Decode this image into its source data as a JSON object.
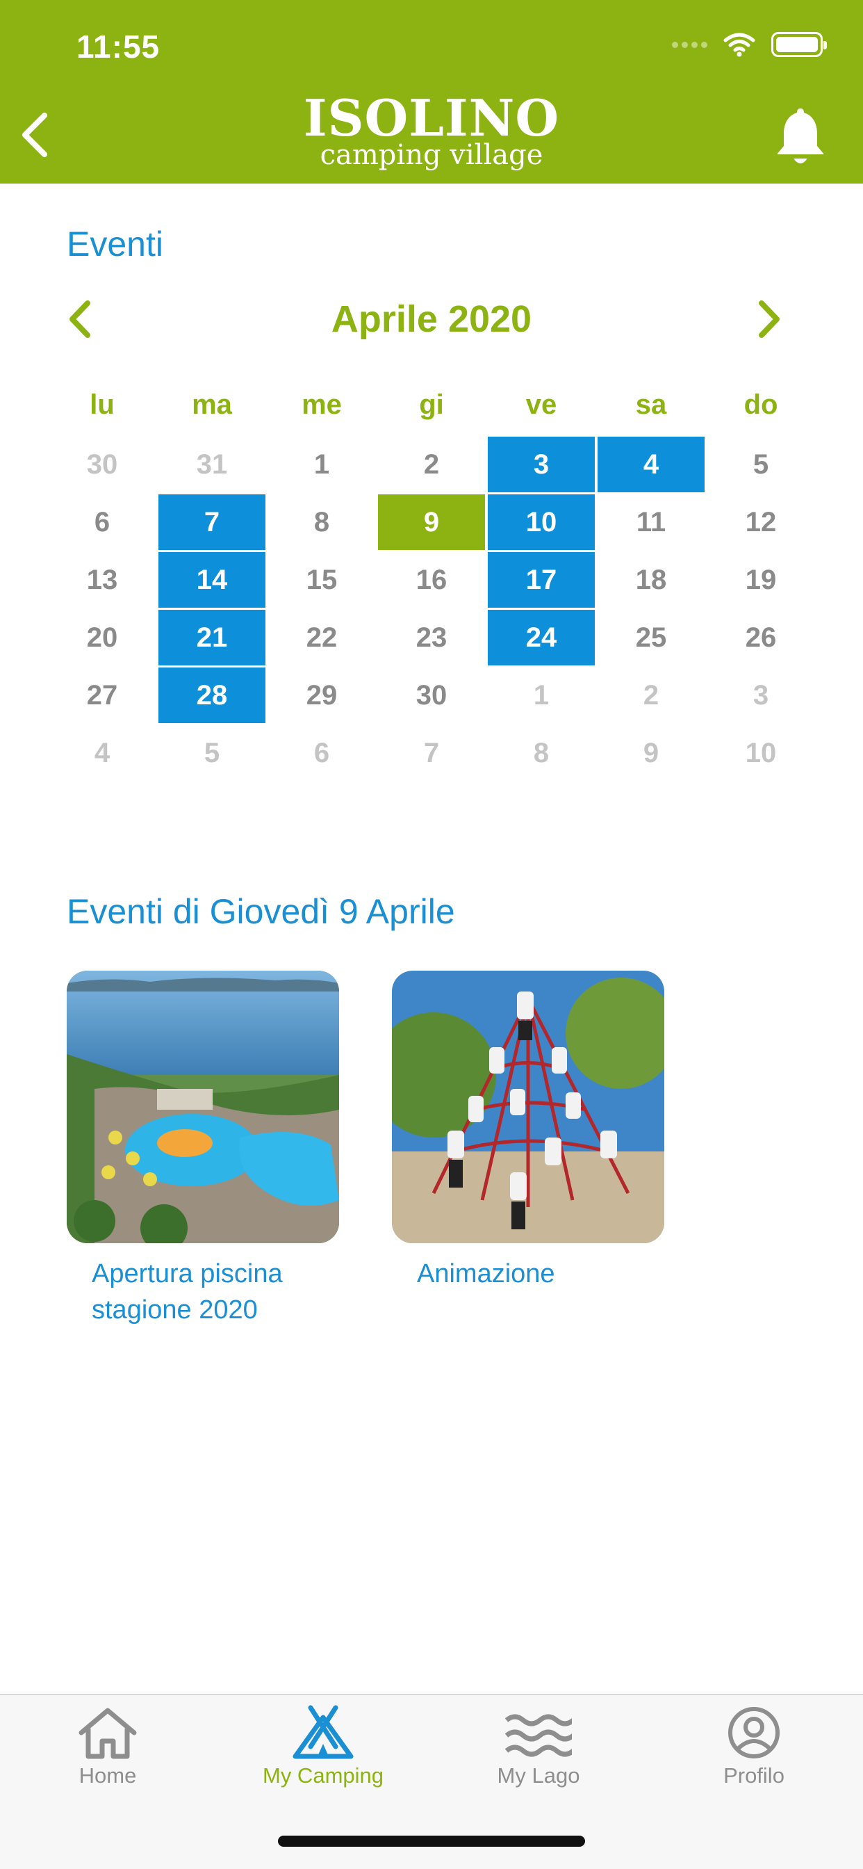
{
  "status_bar": {
    "time": "11:55"
  },
  "header": {
    "logo_main": "ISOLINO",
    "logo_sub": "camping village",
    "brand_color": "#8db312"
  },
  "events_section": {
    "title": "Eventi"
  },
  "calendar": {
    "month_label": "Aprile 2020",
    "weekdays": [
      "lu",
      "ma",
      "me",
      "gi",
      "ve",
      "sa",
      "do"
    ],
    "event_color": "#0d8fd9",
    "selected_color": "#8db312",
    "weeks": [
      [
        {
          "d": "30",
          "m": true
        },
        {
          "d": "31",
          "m": true
        },
        {
          "d": "1"
        },
        {
          "d": "2"
        },
        {
          "d": "3",
          "e": true
        },
        {
          "d": "4",
          "e": true
        },
        {
          "d": "5"
        }
      ],
      [
        {
          "d": "6"
        },
        {
          "d": "7",
          "e": true
        },
        {
          "d": "8"
        },
        {
          "d": "9",
          "s": true
        },
        {
          "d": "10",
          "e": true
        },
        {
          "d": "11"
        },
        {
          "d": "12"
        }
      ],
      [
        {
          "d": "13"
        },
        {
          "d": "14",
          "e": true
        },
        {
          "d": "15"
        },
        {
          "d": "16"
        },
        {
          "d": "17",
          "e": true
        },
        {
          "d": "18"
        },
        {
          "d": "19"
        }
      ],
      [
        {
          "d": "20"
        },
        {
          "d": "21",
          "e": true
        },
        {
          "d": "22"
        },
        {
          "d": "23"
        },
        {
          "d": "24",
          "e": true
        },
        {
          "d": "25"
        },
        {
          "d": "26"
        }
      ],
      [
        {
          "d": "27"
        },
        {
          "d": "28",
          "e": true
        },
        {
          "d": "29"
        },
        {
          "d": "30"
        },
        {
          "d": "1",
          "m": true
        },
        {
          "d": "2",
          "m": true
        },
        {
          "d": "3",
          "m": true
        }
      ],
      [
        {
          "d": "4",
          "m": true
        },
        {
          "d": "5",
          "m": true
        },
        {
          "d": "6",
          "m": true
        },
        {
          "d": "7",
          "m": true
        },
        {
          "d": "8",
          "m": true
        },
        {
          "d": "9",
          "m": true
        },
        {
          "d": "10",
          "m": true
        }
      ]
    ]
  },
  "day_events": {
    "title": "Eventi di Giovedì 9 Aprile",
    "items": [
      {
        "name": "Apertura piscina stagione 2020"
      },
      {
        "name": "Animazione"
      }
    ]
  },
  "tabbar": {
    "items": [
      {
        "label": "Home",
        "icon": "home-icon"
      },
      {
        "label": "My Camping",
        "icon": "tent-icon",
        "active": true
      },
      {
        "label": "My Lago",
        "icon": "waves-icon"
      },
      {
        "label": "Profilo",
        "icon": "profile-icon"
      }
    ]
  }
}
